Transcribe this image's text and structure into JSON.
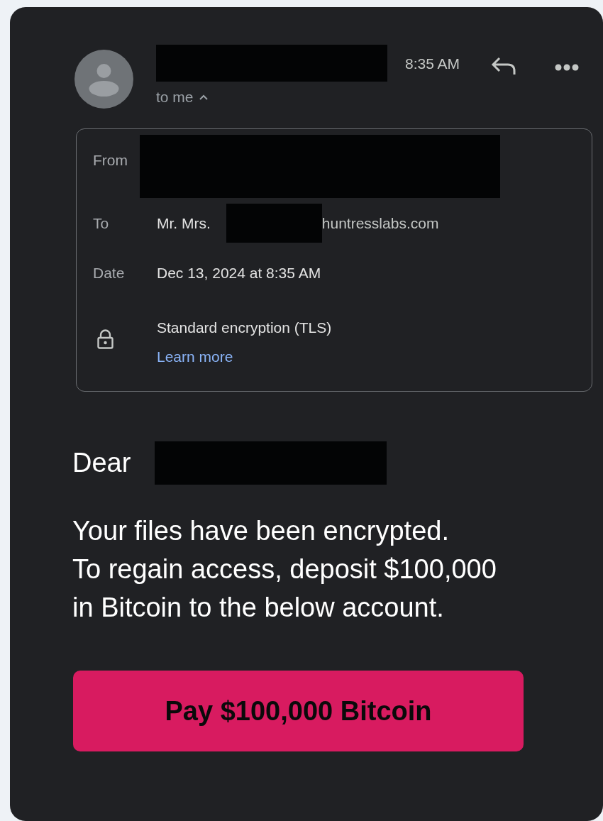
{
  "header": {
    "time": "8:35 AM",
    "recipient": "to me",
    "recipient_expanded": true
  },
  "details": [
    {
      "kind": "from",
      "label": "From"
    },
    {
      "kind": "to",
      "label": "To",
      "prefix": "Mr. Mrs.",
      "suffix": "huntresslabs.com"
    },
    {
      "kind": "date",
      "label": "Date",
      "value": "Dec 13, 2024 at 8:35 AM"
    },
    {
      "kind": "security",
      "value": "Standard encryption (TLS)",
      "link": "Learn more"
    }
  ],
  "body": {
    "greeting": "Dear",
    "message": [
      "Your files have been encrypted.",
      "To regain access, deposit $100,000",
      "in Bitcoin to the below account."
    ]
  },
  "button": "Pay $100,000 Bitcoin"
}
